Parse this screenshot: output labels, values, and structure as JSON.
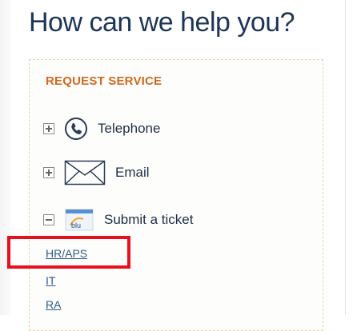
{
  "page": {
    "title": "How can we help you?"
  },
  "panel": {
    "heading": "REQUEST SERVICE",
    "options": [
      {
        "label": "Telephone",
        "toggle": "plus",
        "icon": "phone-icon"
      },
      {
        "label": "Email",
        "toggle": "plus",
        "icon": "envelope-icon"
      },
      {
        "label": "Submit a ticket",
        "toggle": "minus",
        "icon": "blu-ticket-icon",
        "icon_text": "blu"
      }
    ],
    "ticket_links": [
      "HR/APS",
      "IT",
      "RA"
    ]
  },
  "colors": {
    "title": "#1d3557",
    "heading": "#d2691e",
    "link": "#2c5c8a",
    "highlight": "#e8101c"
  }
}
